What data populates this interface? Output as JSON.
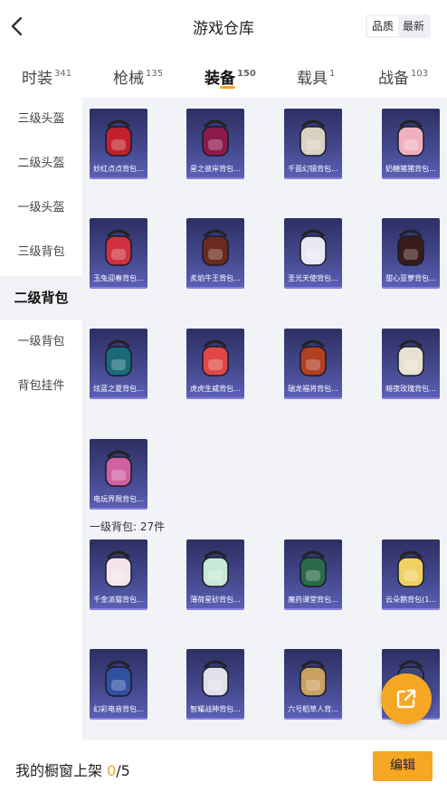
{
  "header": {
    "title": "游戏仓库",
    "sort": [
      "品质",
      "最新"
    ]
  },
  "tabs": [
    {
      "label": "时装",
      "count": "341"
    },
    {
      "label": "枪械",
      "count": "135"
    },
    {
      "label": "装备",
      "count": "150"
    },
    {
      "label": "载具",
      "count": "1"
    },
    {
      "label": "战备",
      "count": "103"
    }
  ],
  "sidebar": [
    "三级头盔",
    "二级头盔",
    "一级头盔",
    "三级背包",
    "二级背包",
    "一级背包",
    "背包挂件"
  ],
  "section_label": "一级背包: 27件",
  "items": [
    {
      "name": "妙红点点背包...",
      "color": "#c0202a"
    },
    {
      "name": "星之彼岸背包...",
      "color": "#8a1a4a"
    },
    {
      "name": "千面幻镜背包...",
      "color": "#d8d2c0"
    },
    {
      "name": "奶糖猪猪背包...",
      "color": "#f0b0c0"
    },
    {
      "name": "玉兔迎春背包...",
      "color": "#d03040"
    },
    {
      "name": "炙焰牛王背包...",
      "color": "#6a2a20"
    },
    {
      "name": "圣光天使背包...",
      "color": "#e8e8f4"
    },
    {
      "name": "甜心亚萝背包...",
      "color": "#3a1a1a"
    },
    {
      "name": "炫蓝之夏背包...",
      "color": "#1a6a7a"
    },
    {
      "name": "虎虎生威背包...",
      "color": "#e04848"
    },
    {
      "name": "瑞龙福将背包...",
      "color": "#b04020"
    },
    {
      "name": "暗夜玫瑰背包...",
      "color": "#e8e0d0"
    },
    {
      "name": "电玩界限背包...",
      "color": "#d060a0"
    },
    {
      "name": "千金派猫背包...",
      "color": "#f4e4ec"
    },
    {
      "name": "薄荷星砂背包...",
      "color": "#c8e8d8"
    },
    {
      "name": "魔药课堂背包...",
      "color": "#2a6a4a"
    },
    {
      "name": "云朵鹅背包(1...",
      "color": "#f0d060"
    },
    {
      "name": "幻彩电音背包...",
      "color": "#3050a0"
    },
    {
      "name": "智耀战神背包...",
      "color": "#e0e0e8"
    },
    {
      "name": "六号稻草人背...",
      "color": "#c8a060"
    },
    {
      "name": "...",
      "color": "#404878"
    }
  ],
  "shelf": {
    "label": "我的橱窗上架 ",
    "current": "0",
    "total": "/5"
  },
  "edit": "编辑"
}
